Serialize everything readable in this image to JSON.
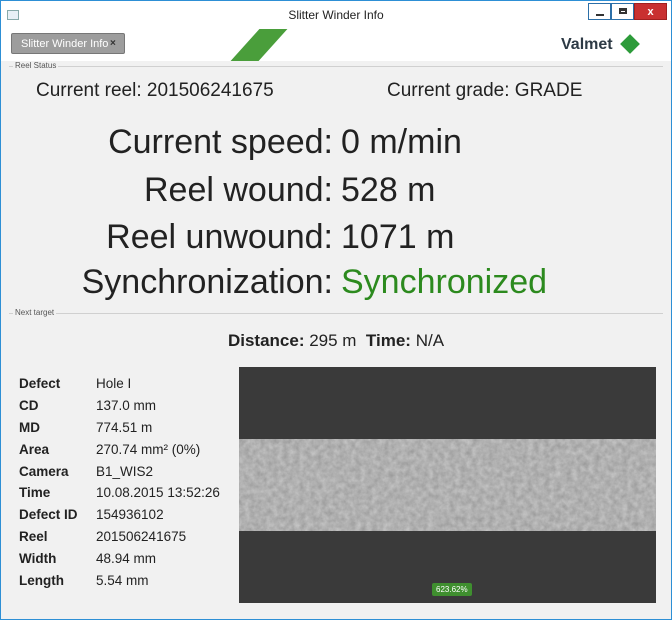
{
  "window": {
    "title": "Slitter Winder Info"
  },
  "tab": {
    "label": "Slitter Winder Info",
    "close": "×"
  },
  "brand": {
    "logo": "Valmet"
  },
  "reel_status": {
    "group_label": "Reel Status",
    "current_reel_label": "Current reel:",
    "current_reel_value": "201506241675",
    "current_grade_label": "Current grade:",
    "current_grade_value": "GRADE",
    "rows": [
      {
        "label": "Current speed:",
        "value": "0 m/min"
      },
      {
        "label": "Reel wound:",
        "value": "528 m"
      },
      {
        "label": "Reel unwound:",
        "value": "1071 m"
      },
      {
        "label": "Synchronization:",
        "value": "Synchronized"
      }
    ]
  },
  "next_target": {
    "group_label": "Next target",
    "distance_label": "Distance:",
    "distance_value": "295 m",
    "time_label": "Time:",
    "time_value": "N/A",
    "details": [
      {
        "key": "Defect",
        "value": "Hole I"
      },
      {
        "key": "CD",
        "value": "137.0 mm"
      },
      {
        "key": "MD",
        "value": "774.51 m"
      },
      {
        "key": "Area",
        "value": "270.74 mm² (0%)"
      },
      {
        "key": "Camera",
        "value": "B1_WIS2"
      },
      {
        "key": "Time",
        "value": "10.08.2015 13:52:26"
      },
      {
        "key": "Defect ID",
        "value": "154936102"
      },
      {
        "key": "Reel",
        "value": "201506241675"
      },
      {
        "key": "Width",
        "value": "48.94 mm"
      },
      {
        "key": "Length",
        "value": "5.54 mm"
      }
    ],
    "image_zoom": "623.62%"
  },
  "colors": {
    "accent_green": "#2c8a1e",
    "window_border": "#2d8fd5",
    "close_red": "#c93030"
  }
}
